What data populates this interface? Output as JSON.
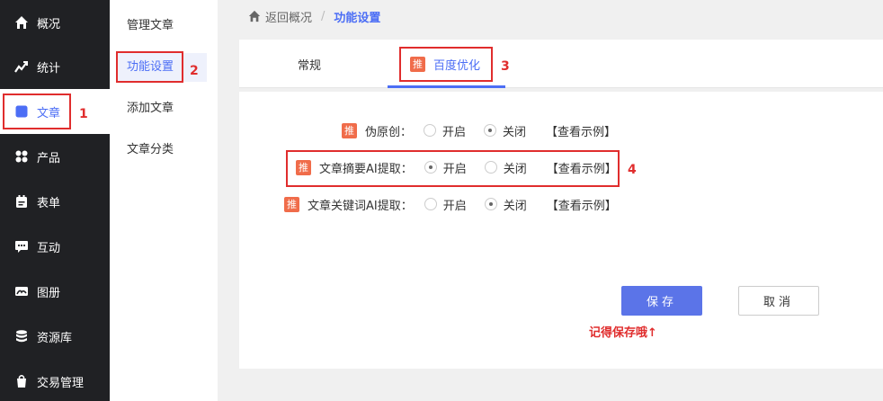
{
  "sidebar": {
    "items": [
      {
        "label": "概况",
        "icon": "home-icon"
      },
      {
        "label": "统计",
        "icon": "chart-icon"
      },
      {
        "label": "文章",
        "icon": "article-icon"
      },
      {
        "label": "产品",
        "icon": "grid-icon"
      },
      {
        "label": "表单",
        "icon": "form-icon"
      },
      {
        "label": "互动",
        "icon": "chat-icon"
      },
      {
        "label": "图册",
        "icon": "gallery-icon"
      },
      {
        "label": "资源库",
        "icon": "database-icon"
      },
      {
        "label": "交易管理",
        "icon": "trade-icon"
      }
    ]
  },
  "submenu": {
    "items": [
      {
        "label": "管理文章"
      },
      {
        "label": "功能设置"
      },
      {
        "label": "添加文章"
      },
      {
        "label": "文章分类"
      }
    ]
  },
  "breadcrumb": {
    "back": "返回概况",
    "separator": "/",
    "current": "功能设置"
  },
  "tabs": [
    {
      "label": "常规"
    },
    {
      "label": "百度优化",
      "badge": "推"
    }
  ],
  "settings": [
    {
      "badge": "推",
      "label": "伪原创：",
      "on_label": "开启",
      "off_label": "关闭",
      "selected": "off",
      "example": "【查看示例】"
    },
    {
      "badge": "推",
      "label": "文章摘要AI提取：",
      "on_label": "开启",
      "off_label": "关闭",
      "selected": "on",
      "example": "【查看示例】"
    },
    {
      "badge": "推",
      "label": "文章关键词AI提取：",
      "on_label": "开启",
      "off_label": "关闭",
      "selected": "off",
      "example": "【查看示例】"
    }
  ],
  "actions": {
    "save": "保存",
    "cancel": "取消"
  },
  "reminder": "记得保存哦↑",
  "annotations": {
    "n1": "1",
    "n2": "2",
    "n3": "3",
    "n4": "4"
  },
  "colors": {
    "accent": "#4c6ef5",
    "annotation": "#e02d2d",
    "badge": "#f06c4a",
    "sidebar_bg": "#202124"
  }
}
